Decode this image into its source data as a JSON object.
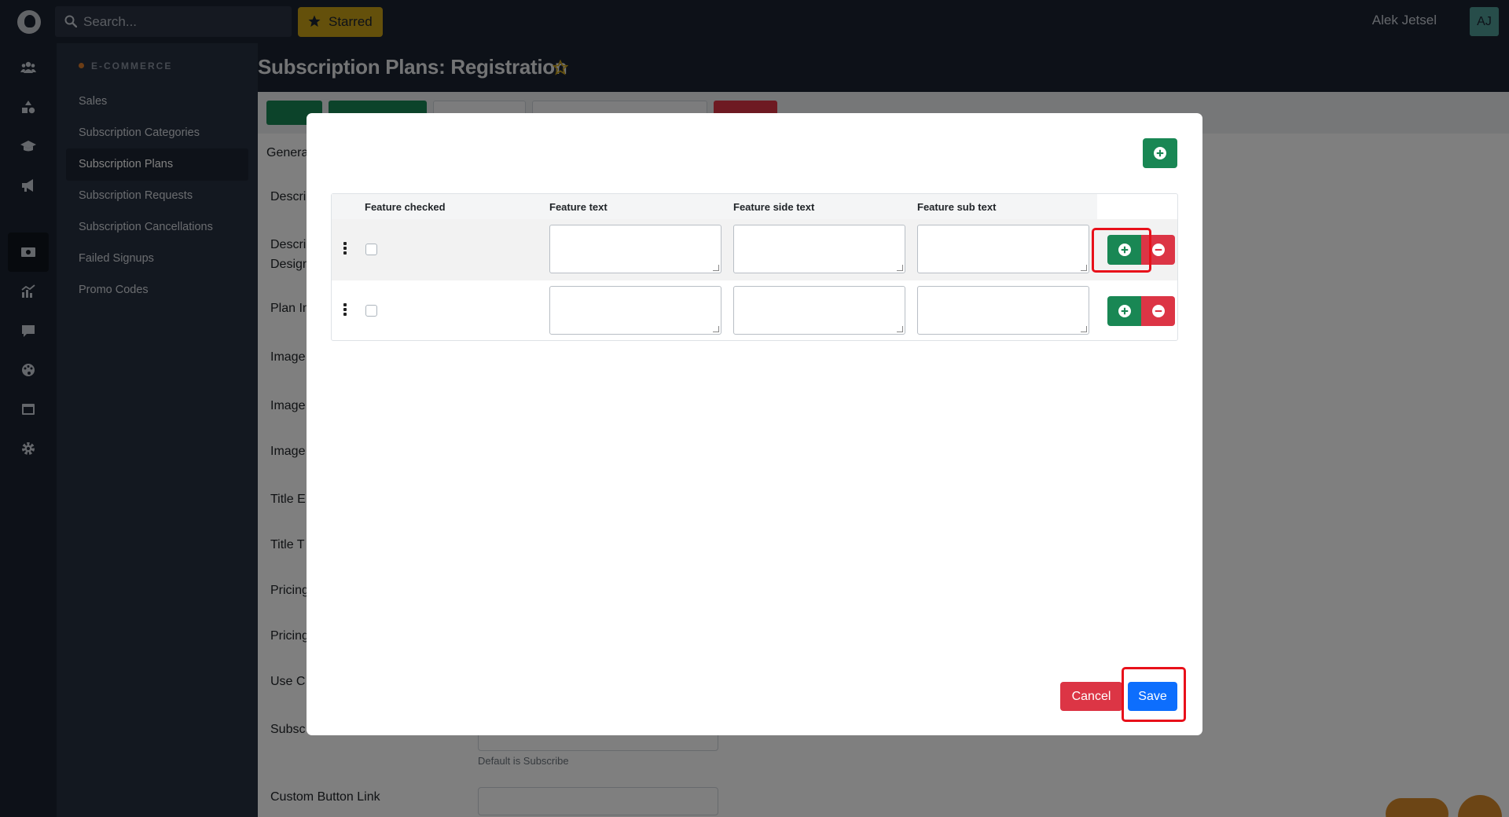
{
  "topbar": {
    "search_placeholder": "Search...",
    "starred_label": "Starred",
    "user_name": "Alek Jetsel",
    "avatar_initials": "AJ"
  },
  "rail": {
    "icons": [
      "users-icon",
      "shapes-icon",
      "graduation-cap-icon",
      "megaphone-icon",
      "money-bill-icon",
      "chart-icon",
      "comment-icon",
      "palette-icon",
      "window-icon",
      "gear-icon"
    ],
    "active_icon": "money-bill-icon"
  },
  "sidebar": {
    "section": "E-COMMERCE",
    "items": [
      {
        "label": "Sales"
      },
      {
        "label": "Subscription Categories"
      },
      {
        "label": "Subscription Plans",
        "active": true
      },
      {
        "label": "Subscription Requests"
      },
      {
        "label": "Subscription Cancellations"
      },
      {
        "label": "Failed Signups"
      },
      {
        "label": "Promo Codes"
      }
    ]
  },
  "page": {
    "title": "Subscription Plans: Registration",
    "tab": "Genera",
    "form_labels": [
      "Descri",
      "Descri",
      "Design",
      "Plan In",
      "Image",
      "Image",
      "Image",
      "Title E",
      "Title T",
      "Pricing",
      "Pricing",
      "Use C",
      "Subsc",
      "Custom Button Link"
    ],
    "help_text": "Default is Subscribe"
  },
  "modal": {
    "columns": [
      "Feature checked",
      "Feature text",
      "Feature side text",
      "Feature sub text"
    ],
    "rows": [
      {
        "checked": false,
        "feature_text": "",
        "feature_side_text": "",
        "feature_sub_text": ""
      },
      {
        "checked": false,
        "feature_text": "",
        "feature_side_text": "",
        "feature_sub_text": ""
      }
    ],
    "cancel_label": "Cancel",
    "save_label": "Save"
  },
  "colors": {
    "success": "#198754",
    "danger": "#dc3545",
    "primary": "#0d6efd",
    "highlight": "#e8101a",
    "starred": "#c9a017"
  }
}
